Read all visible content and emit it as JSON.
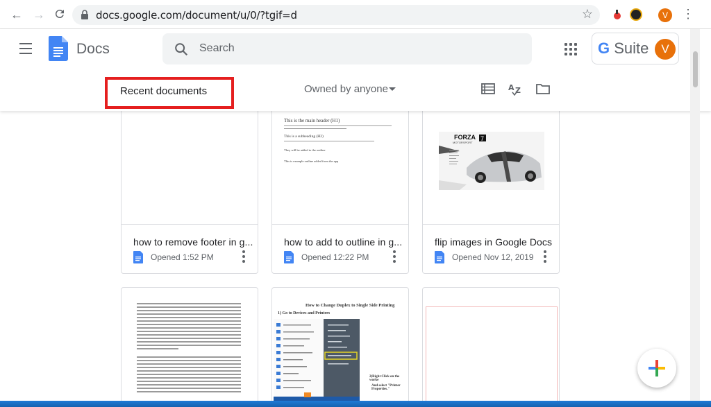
{
  "browser": {
    "url": "docs.google.com/document/u/0/?tgif=d",
    "profile_initial": "V"
  },
  "header": {
    "app_name": "Docs",
    "search_placeholder": "Search",
    "gsuite_g": "G",
    "gsuite_label": "Suite",
    "avatar_initial": "V",
    "recent_label": "Recent documents",
    "owned_by": "Owned by anyone"
  },
  "documents": [
    {
      "title": "how to remove footer in g...",
      "opened": "Opened 1:52 PM"
    },
    {
      "title": "how to add to outline in g...",
      "opened": "Opened 12:22 PM"
    },
    {
      "title": "flip images in Google Docs",
      "opened": "Opened Nov 12, 2019"
    }
  ],
  "thumbs": {
    "outline": {
      "h1": "This is the main header (H1)",
      "h2": "This is a subheading (H2)",
      "p3": "They will be added to the outline",
      "p4": "This is example outline added from the app"
    },
    "duplex": {
      "title": "How to Change Duplex to Single Side Printing",
      "step1": "1) Go to Devices and Printers",
      "step2": "2)Right Click on the worke",
      "step3": "And select \"Printer Properties.\""
    },
    "forza": {
      "brand": "FORZA",
      "sub": "MOTORSPORT",
      "num": "7"
    }
  },
  "colors": {
    "accent_red": "#e51f1f",
    "google_blue": "#4285f4",
    "avatar_orange": "#e8710a"
  }
}
